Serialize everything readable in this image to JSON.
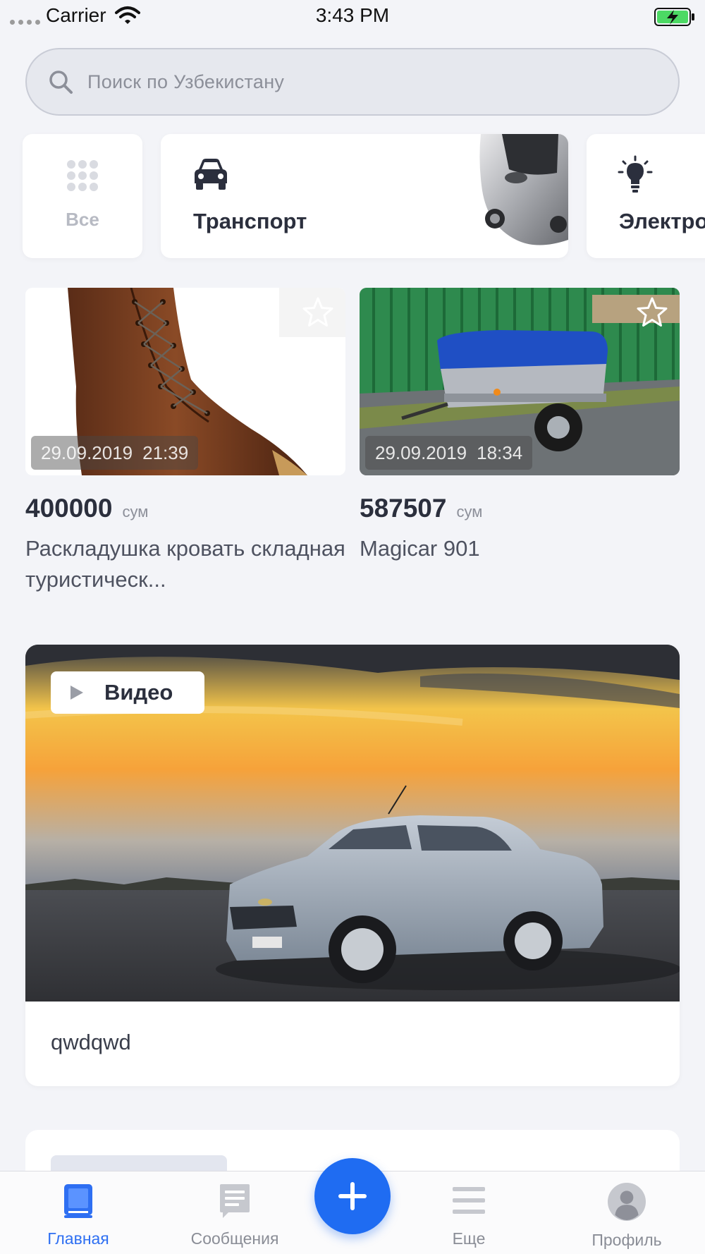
{
  "status_bar": {
    "carrier": "Carrier",
    "time": "3:43 PM"
  },
  "search": {
    "placeholder": "Поиск по Узбекистану"
  },
  "categories": [
    {
      "label": "Все",
      "icon": "grid-icon"
    },
    {
      "label": "Транспорт",
      "icon": "car-icon"
    },
    {
      "label": "Электро",
      "icon": "bulb-icon"
    }
  ],
  "listings": [
    {
      "date": "29.09.2019",
      "time": "21:39",
      "price": "400000",
      "currency": "сум",
      "title": "Раскладушка кровать складная туристическ...",
      "image": "brown leather boot"
    },
    {
      "date": "29.09.2019",
      "time": "18:34",
      "price": "587507",
      "currency": "сум",
      "title": "Magicar 901",
      "image": "car trailer with blue cover"
    }
  ],
  "video_card": {
    "badge": "Видео",
    "title": "qwdqwd",
    "image": "silver sedan at sunset"
  },
  "tab_bar": {
    "items": [
      {
        "label": "Главная",
        "icon": "home-book-icon",
        "active": true
      },
      {
        "label": "Сообщения",
        "icon": "messages-icon",
        "active": false
      },
      {
        "label": "Еще",
        "icon": "menu-icon",
        "active": false
      },
      {
        "label": "Профиль",
        "icon": "profile-icon",
        "active": false
      }
    ],
    "fab_icon": "plus-icon"
  },
  "colors": {
    "accent": "#1f6cf2",
    "background": "#f3f4f8",
    "text": "#2b2f3d",
    "muted": "#8c8f99"
  }
}
